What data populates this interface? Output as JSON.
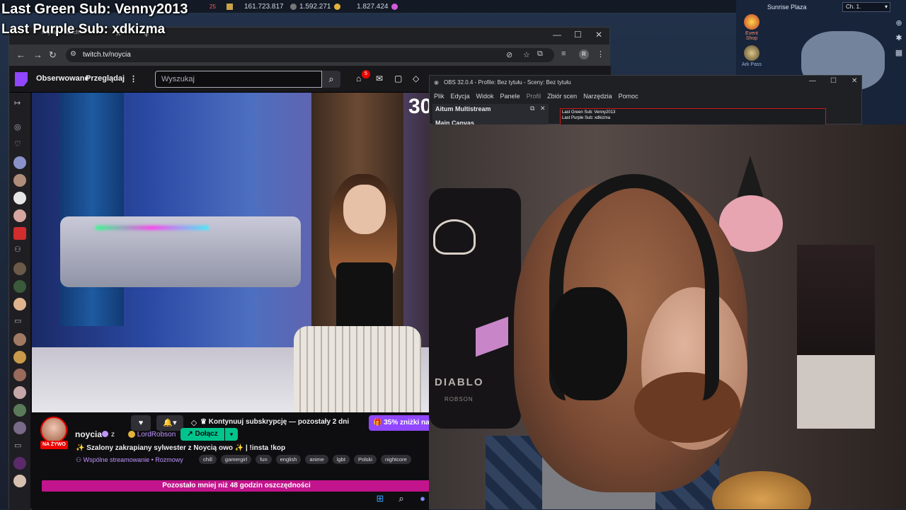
{
  "overlay": {
    "green_sub": "Last Green Sub: Venny2013",
    "purple_sub": "Last Purple Sub: xdkizma"
  },
  "game": {
    "currency1": "161.723.817",
    "currency2": "1.592.271",
    "currency3": "1.827.424",
    "badge_count": "25",
    "zone": "Sunrise Plaza",
    "channel": "Ch. 1.",
    "event_shop": "Event Shop",
    "ark_pass": "Ark Pass"
  },
  "browser": {
    "tab_title": "noycia - Twitch",
    "url": "twitch.tv/noycia",
    "profile_initial": "R"
  },
  "twitch": {
    "nav_following": "Obserwowane",
    "nav_browse": "Przeglądaj",
    "search_placeholder": "Wyszukaj",
    "notif_count": "5",
    "timer": "30",
    "sub_continue": "Kontynuuj subskrypcję — pozostały 2 dni",
    "gift_label": "35% zniżki na",
    "channel_name": "noycia",
    "with": "z",
    "collab_name": "LordRobson",
    "join_label": "Dołącz",
    "live_label": "NA ŻYWO",
    "stream_title": "✨ Szalony zakrapiany sylwester z Noycią owo ✨ | !insta !kop",
    "category": "Wspólne streamowanie • Rozmowy",
    "tags": [
      "chill",
      "gamergirl",
      "fun",
      "english",
      "anime",
      "lgbt",
      "Polski",
      "nightcore"
    ],
    "banner": "Pozostało mniej niż 48 godzin oszczędności"
  },
  "obs": {
    "title": "OBS 32.0.4 - Profile: Bez tytułu - Sceny: Bez tytułu",
    "menu": [
      "Plik",
      "Edycja",
      "Widok",
      "Panele",
      "Profil",
      "Zbiór scen",
      "Narzędzia",
      "Pomoc"
    ],
    "dock_title": "Aitum Multistream",
    "canvas_label": "Main Canvas",
    "preview_line1": "Last Green Sub: Venny2013",
    "preview_line2": "Last Purple Sub: xdkizma"
  },
  "webcam": {
    "chair_brand": "DIABLO",
    "chair_name": "ROBSON"
  },
  "colors": {
    "twitch_purple": "#9146ff",
    "live_red": "#eb0400",
    "join_green": "#00c48c",
    "banner_pink": "#c2148c"
  }
}
